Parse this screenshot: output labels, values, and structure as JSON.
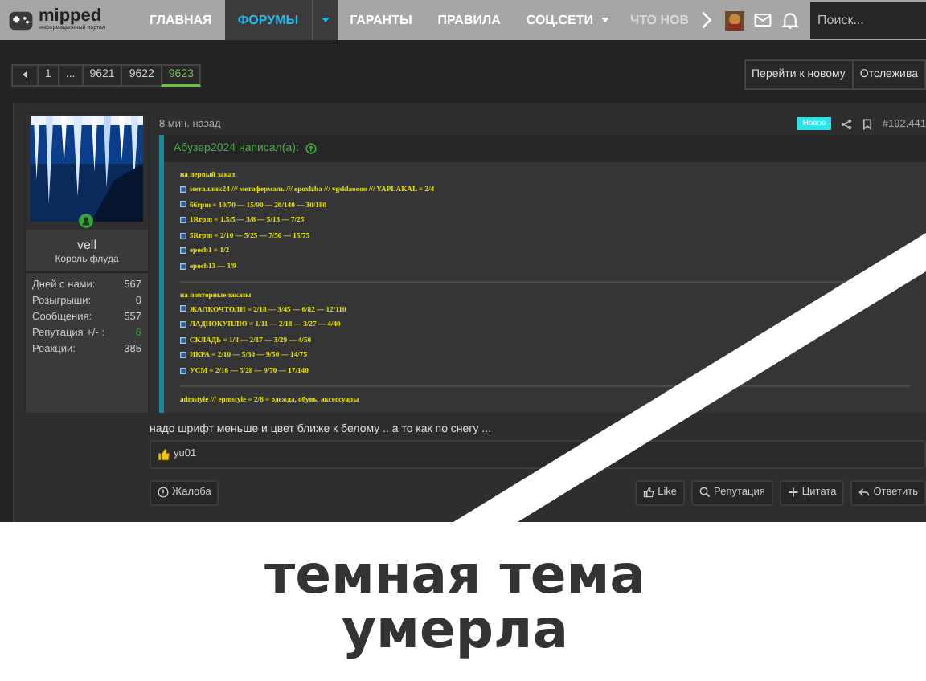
{
  "nav": {
    "logo": "mipped",
    "logo_subtitle": "информационный портал",
    "items": [
      {
        "label": "ГЛАВНАЯ",
        "selected": false,
        "menu": false
      },
      {
        "label": "ФОРУМЫ",
        "selected": true,
        "menu": true
      },
      {
        "label": "ГАРАНТЫ",
        "selected": false,
        "menu": false
      },
      {
        "label": "ПРАВИЛА",
        "selected": false,
        "menu": false
      },
      {
        "label": "СОЦ.СЕТИ",
        "selected": false,
        "menu": true
      },
      {
        "label": "ЧТО НОВ",
        "selected": false,
        "menu": false
      }
    ],
    "search": {
      "placeholder": "Поиск..."
    }
  },
  "pagination": {
    "pages": [
      {
        "label": "1",
        "selected": false
      },
      {
        "label": "...",
        "selected": false
      },
      {
        "label": "9621",
        "selected": false
      },
      {
        "label": "9622",
        "selected": false
      },
      {
        "label": "9623",
        "selected": true
      }
    ],
    "actions": [
      "Перейти к новому",
      "Отслежива"
    ]
  },
  "post": {
    "user": {
      "name": "vell",
      "title": "Король флуда",
      "online": true,
      "stats": [
        {
          "label": "Дней с нами:",
          "value": "567",
          "kind": "count"
        },
        {
          "label": "Розыгрыши:",
          "value": "0",
          "kind": "count"
        },
        {
          "label": "Сообщения:",
          "value": "557",
          "kind": "count"
        },
        {
          "label": "Репутация +/- :",
          "value": "6",
          "kind": "reputation"
        },
        {
          "label": "Реакции:",
          "value": "385",
          "kind": "count"
        }
      ]
    },
    "time": "8 мин. назад",
    "badge": "Новое",
    "number": "#192,441",
    "quote": {
      "author": "Абузер2024 написал(а):",
      "sections": [
        {
          "heading": "на первый заказ",
          "lines": [
            "металлик24 /// метафермаль /// epoxlzba /// vgsklaoooo /// YAPLAKAL = 2/4",
            "66rpm = 10/70 — 15/90 — 20/140 — 30/180",
            "1Rrpm = 1.5/5 — 3/8 — 5/13 — 7/25",
            "5Rrpm = 2/10 — 5/25 — 7/50 — 15/75",
            "epocb1 = 1/2",
            "epocb13 — 3/9"
          ]
        },
        {
          "heading": "на повторные заказы",
          "lines": [
            "ЖАЛКОЧТОЛИ = 2/18 — 3/45 — 6/82 — 12/110",
            "ЛАДНОКУПЛЮ = 1/11 — 2/18 — 3/27 — 4/40",
            "СКЛАДЬ = 1/8 — 2/17 — 3/29 — 4/50",
            "ИКРА = 2/10 — 5/30 — 9/50 — 14/75",
            "УСМ = 2/16 — 5/28 — 9/70 — 17/140"
          ]
        }
      ],
      "footer": "admstyle /// epmstyle = 2/8 = одежда, обувь, аксессуары"
    },
    "text": "надо шрифт меньше и цвет ближе к белому .. а то как по снегу ...",
    "reaction": "yu01",
    "report": "Жалоба",
    "buttons": [
      {
        "label": "Like",
        "kind": "like"
      },
      {
        "label": "Репутация",
        "kind": "search"
      },
      {
        "label": "Цитата",
        "kind": "plus"
      },
      {
        "label": "Ответить",
        "kind": "reply"
      }
    ]
  },
  "caption": [
    "темная тема",
    "умерла"
  ]
}
